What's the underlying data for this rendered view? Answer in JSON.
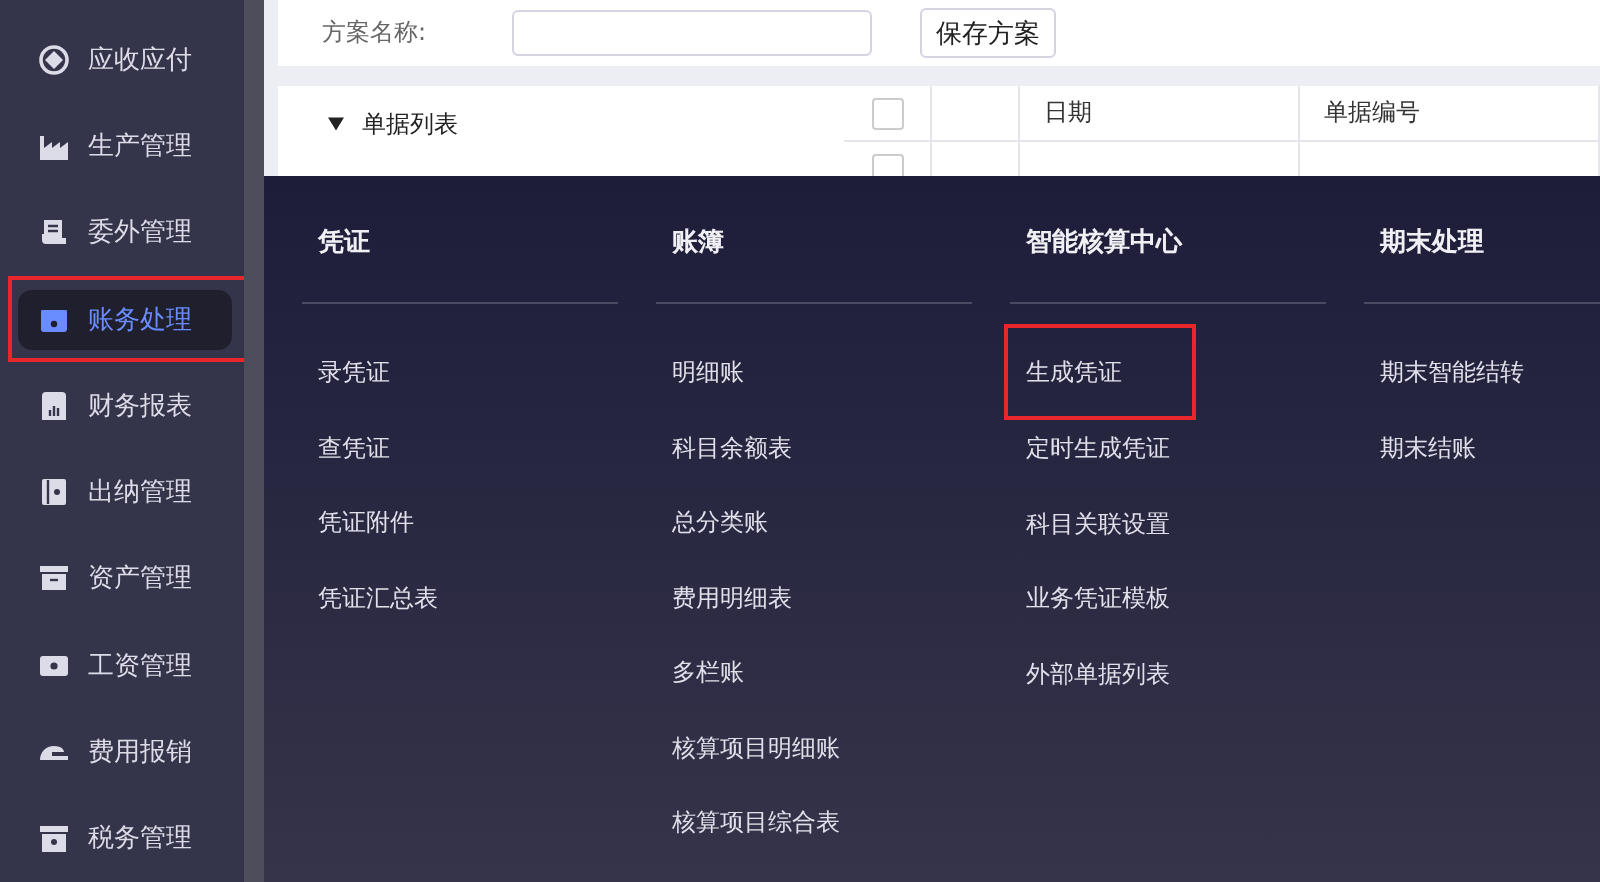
{
  "sidebar": {
    "items": [
      {
        "label": "应收应付",
        "selected": false,
        "annotated": false
      },
      {
        "label": "生产管理",
        "selected": false,
        "annotated": false
      },
      {
        "label": "委外管理",
        "selected": false,
        "annotated": false
      },
      {
        "label": "账务处理",
        "selected": true,
        "annotated": true
      },
      {
        "label": "财务报表",
        "selected": false,
        "annotated": false
      },
      {
        "label": "出纳管理",
        "selected": false,
        "annotated": false
      },
      {
        "label": "资产管理",
        "selected": false,
        "annotated": false
      },
      {
        "label": "工资管理",
        "selected": false,
        "annotated": false
      },
      {
        "label": "费用报销",
        "selected": false,
        "annotated": false
      },
      {
        "label": "税务管理",
        "selected": false,
        "annotated": false
      }
    ]
  },
  "form": {
    "label": "方案名称:",
    "button": "保存方案"
  },
  "tree": {
    "items": [
      {
        "label": "单据列表",
        "expanded": true
      }
    ]
  },
  "table": {
    "all_checked": false,
    "columns": [
      "日期",
      "单据编号"
    ],
    "rows": [
      {
        "checked": false
      }
    ]
  },
  "menu": {
    "columns": [
      {
        "heading": "凭证",
        "items": [
          {
            "label": "录凭证",
            "annotated": false
          },
          {
            "label": "查凭证",
            "annotated": false
          },
          {
            "label": "凭证附件",
            "annotated": false
          },
          {
            "label": "凭证汇总表",
            "annotated": false
          }
        ]
      },
      {
        "heading": "账簿",
        "items": [
          {
            "label": "明细账",
            "annotated": false
          },
          {
            "label": "科目余额表",
            "annotated": false
          },
          {
            "label": "总分类账",
            "annotated": false
          },
          {
            "label": "费用明细表",
            "annotated": false
          },
          {
            "label": "多栏账",
            "annotated": false
          },
          {
            "label": "核算项目明细账",
            "annotated": false
          },
          {
            "label": "核算项目综合表",
            "annotated": false
          }
        ]
      },
      {
        "heading": "智能核算中心",
        "items": [
          {
            "label": "生成凭证",
            "annotated": true
          },
          {
            "label": "定时生成凭证",
            "annotated": false
          },
          {
            "label": "科目关联设置",
            "annotated": false
          },
          {
            "label": "业务凭证模板",
            "annotated": false
          },
          {
            "label": "外部单据列表",
            "annotated": false
          }
        ]
      },
      {
        "heading": "期末处理",
        "items": [
          {
            "label": "期末智能结转",
            "annotated": false
          },
          {
            "label": "期末结账",
            "annotated": false
          }
        ]
      }
    ]
  }
}
